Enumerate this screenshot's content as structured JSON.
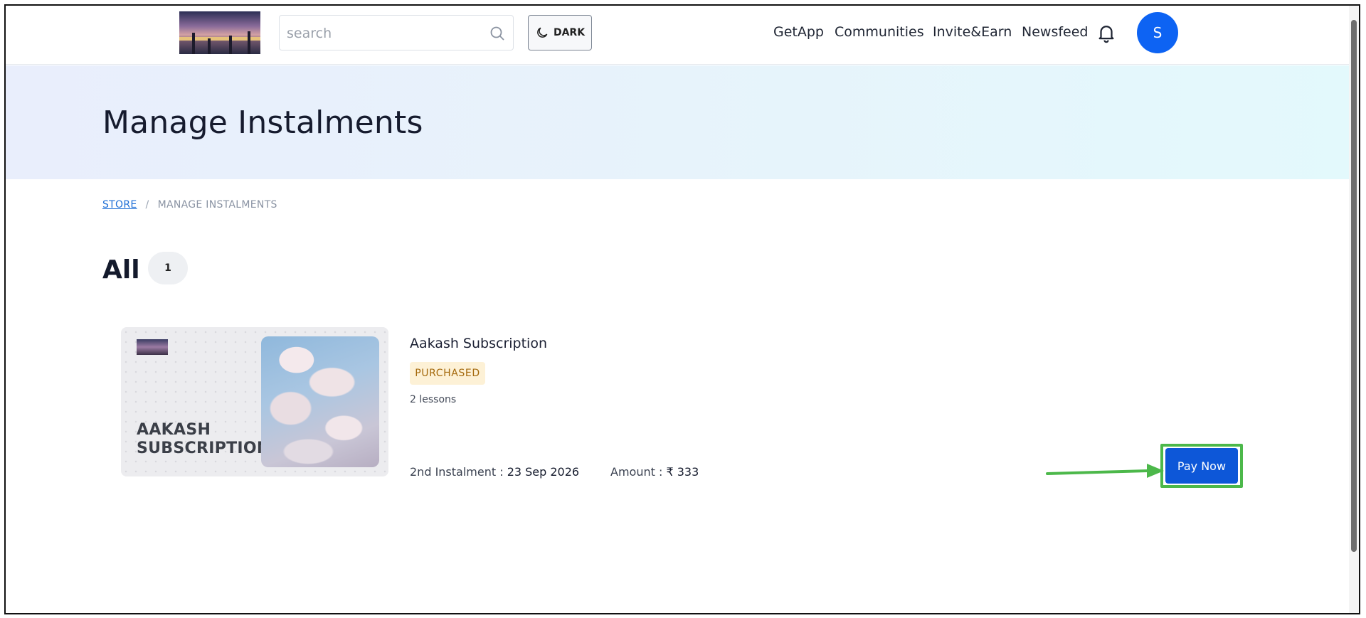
{
  "header": {
    "search_placeholder": "search",
    "theme_toggle_label": "DARK",
    "nav": [
      "GetApp",
      "Communities",
      "Invite&Earn",
      "Newsfeed"
    ],
    "avatar_initial": "S",
    "icons": {
      "search": "search-icon",
      "theme": "moon-icon",
      "notifications": "bell-icon"
    }
  },
  "banner": {
    "title": "Manage Instalments"
  },
  "breadcrumb": {
    "root": "STORE",
    "separator": "/",
    "current": "MANAGE INSTALMENTS"
  },
  "list": {
    "heading": "All",
    "count": "1"
  },
  "course": {
    "thumbnail_text_line1": "AAKASH",
    "thumbnail_text_line2": "SUBSCRIPTION",
    "title": "Aakash Subscription",
    "status": "PURCHASED",
    "lessons": "2 lessons",
    "instalment_label": "2nd Instalment : ",
    "instalment_date": "23 Sep 2026",
    "amount_label": "Amount : ",
    "amount_value": "₹ 333",
    "pay_button": "Pay Now"
  },
  "colors": {
    "primary": "#0d57d8",
    "avatar": "#0d63f3",
    "highlight": "#4cb84a",
    "badge_bg": "#fdf1d6",
    "badge_text": "#a4690c"
  }
}
